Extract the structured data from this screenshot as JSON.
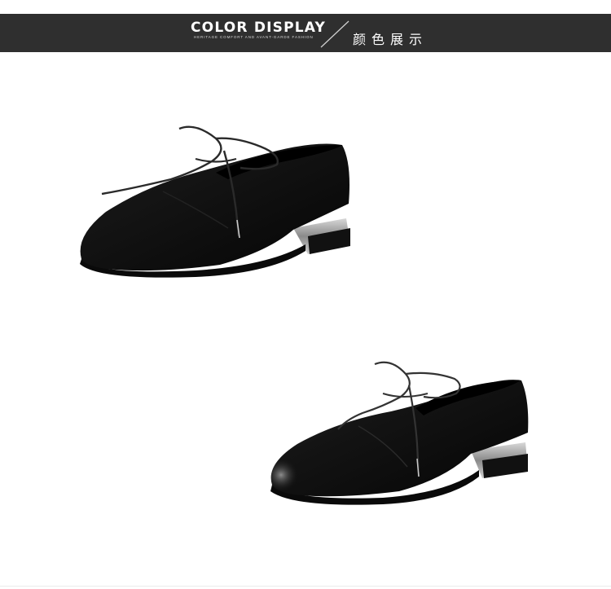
{
  "header": {
    "title": "COLOR DISPLAY",
    "subtitle": "HERITAGE COMFORT AND AVANT-GARDE FASHION",
    "chinese_title": "颜色展示"
  },
  "colors": {
    "header_bg": "#2f2f2f",
    "suede": "#0c0c0c",
    "leather": "#141414",
    "heel_metal": "#9a9a9a"
  },
  "products": [
    {
      "name": "black suede lace-up oxford",
      "icon": "suede-shoe"
    },
    {
      "name": "black leather lace-up oxford",
      "icon": "leather-shoe"
    }
  ]
}
